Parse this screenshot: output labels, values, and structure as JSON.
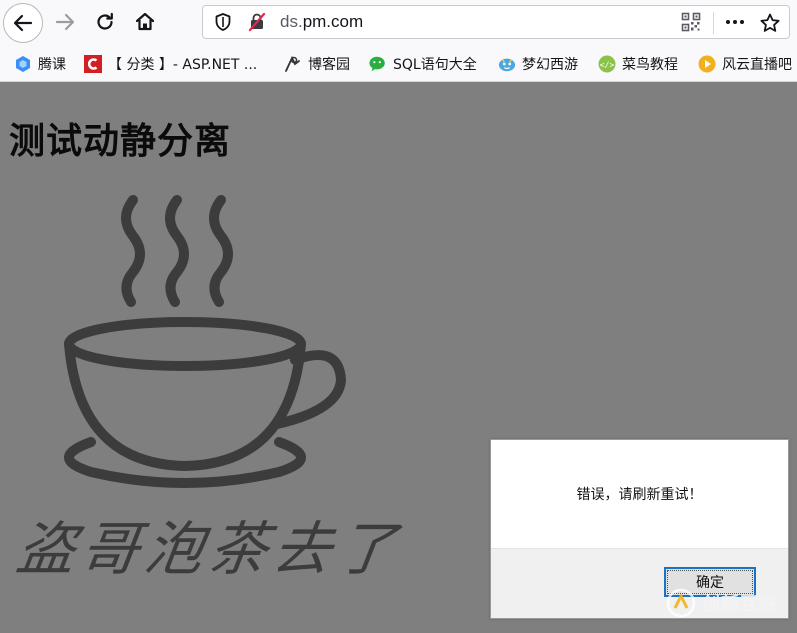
{
  "browser": {
    "url_prefix": "ds.",
    "url_host": "pm.com",
    "icons": {
      "back": "back-arrow-icon",
      "forward": "forward-arrow-icon",
      "reload": "reload-icon",
      "home": "home-icon",
      "shield": "tracking-shield-icon",
      "insecure": "insecure-connection-icon",
      "qr": "qr-code-icon",
      "more": "more-icon",
      "star": "bookmark-star-icon"
    }
  },
  "bookmarks": [
    {
      "label": "腾课",
      "icon": "tengke-icon",
      "color": "#3b8ff0"
    },
    {
      "label": "【 分类 】- ASP.NET ...",
      "icon": "cnblogs-c-icon",
      "color": "#d21f26"
    },
    {
      "label": "博客园",
      "icon": "cnblogs-icon",
      "color": "#333333"
    },
    {
      "label": "SQL语句大全",
      "icon": "wechat-icon",
      "color": "#2aae42"
    },
    {
      "label": "梦幻西游",
      "icon": "menghuan-icon",
      "color": "#4aa7e0"
    },
    {
      "label": "菜鸟教程",
      "icon": "runoob-icon",
      "color": "#8bc34a"
    },
    {
      "label": "风云直播吧",
      "icon": "fengyun-icon",
      "color": "#f0b020"
    }
  ],
  "page": {
    "title": "测试动静分离",
    "image_text": "盗哥泡茶去了"
  },
  "dialog": {
    "message": "错误，请刷新重试！",
    "ok_label": "确定"
  },
  "watermark": {
    "text": "创新互联"
  },
  "colors": {
    "content_bg": "#7f7f7f",
    "cup": "#3c3c3c",
    "dialog_button_border": "#1a73c8"
  }
}
